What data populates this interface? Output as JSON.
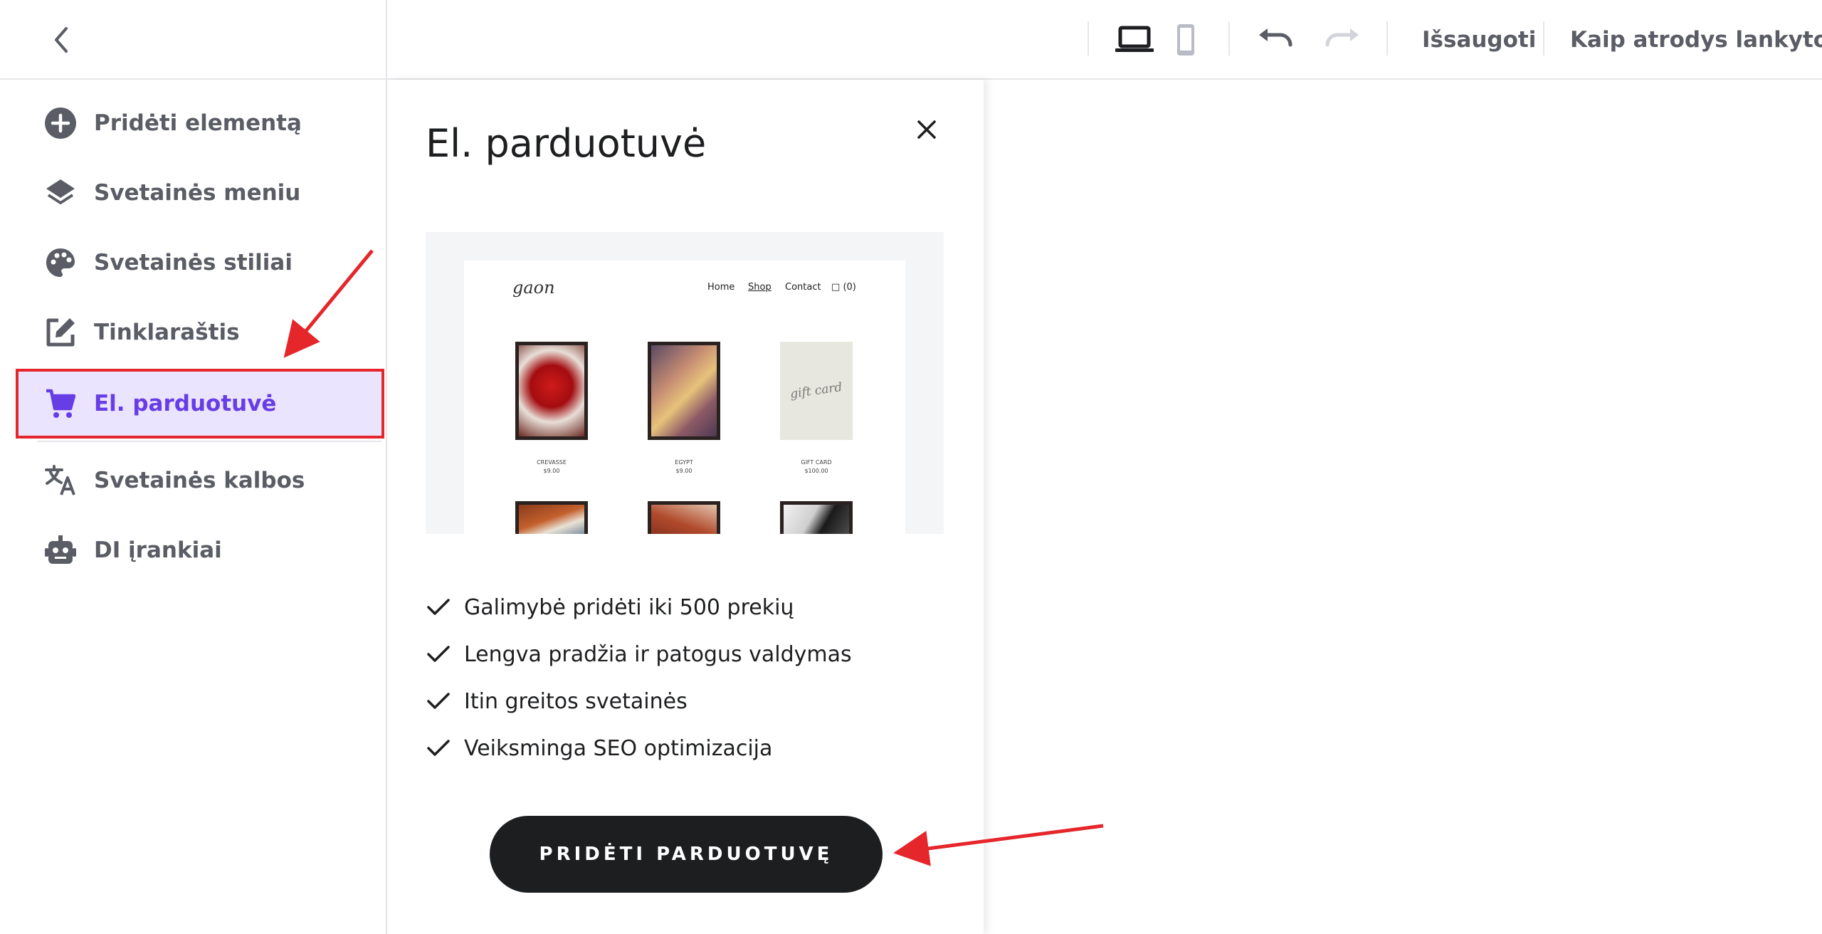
{
  "topbar": {
    "back_icon": "chevron-left-icon",
    "desktop_icon": "laptop-icon",
    "mobile_icon": "smartphone-icon",
    "undo_icon": "undo-icon",
    "redo_icon": "redo-icon",
    "save_label": "Išsaugoti",
    "preview_label": "Kaip atrodys lankytojui"
  },
  "sidebar": {
    "items": [
      {
        "label": "Pridėti elementą",
        "icon": "plus-circle-icon"
      },
      {
        "label": "Svetainės meniu",
        "icon": "layers-icon"
      },
      {
        "label": "Svetainės stiliai",
        "icon": "palette-icon"
      },
      {
        "label": "Tinklaraštis",
        "icon": "edit-icon"
      },
      {
        "label": "El. parduotuvė",
        "icon": "cart-icon",
        "active": true
      },
      {
        "label": "Svetainės kalbos",
        "icon": "translate-icon"
      },
      {
        "label": "DI įrankiai",
        "icon": "robot-icon"
      }
    ]
  },
  "panel": {
    "title": "El. parduotuvė",
    "close_icon": "close-icon",
    "preview": {
      "logo": "gaon",
      "nav": [
        "Home",
        "Shop",
        "Contact",
        "(0)"
      ],
      "gift_text": "gift card",
      "products": [
        {
          "name": "CREVASSE",
          "price": "$9.00"
        },
        {
          "name": "EGYPT",
          "price": "$9.00"
        },
        {
          "name": "GIFT CARD",
          "price": "$100.00"
        }
      ]
    },
    "features": [
      "Galimybė pridėti iki 500 prekių",
      "Lengva pradžia ir patogus valdymas",
      "Itin greitos svetainės",
      "Veiksminga SEO optimizacija"
    ],
    "cta_label": "PRIDĖTI PARDUOTUVĘ"
  },
  "colors": {
    "accent": "#673de6",
    "active_bg": "#ebe4ff",
    "annotation": "#e5262b",
    "dark": "#1d1e20",
    "muted": "#5b5d66"
  }
}
